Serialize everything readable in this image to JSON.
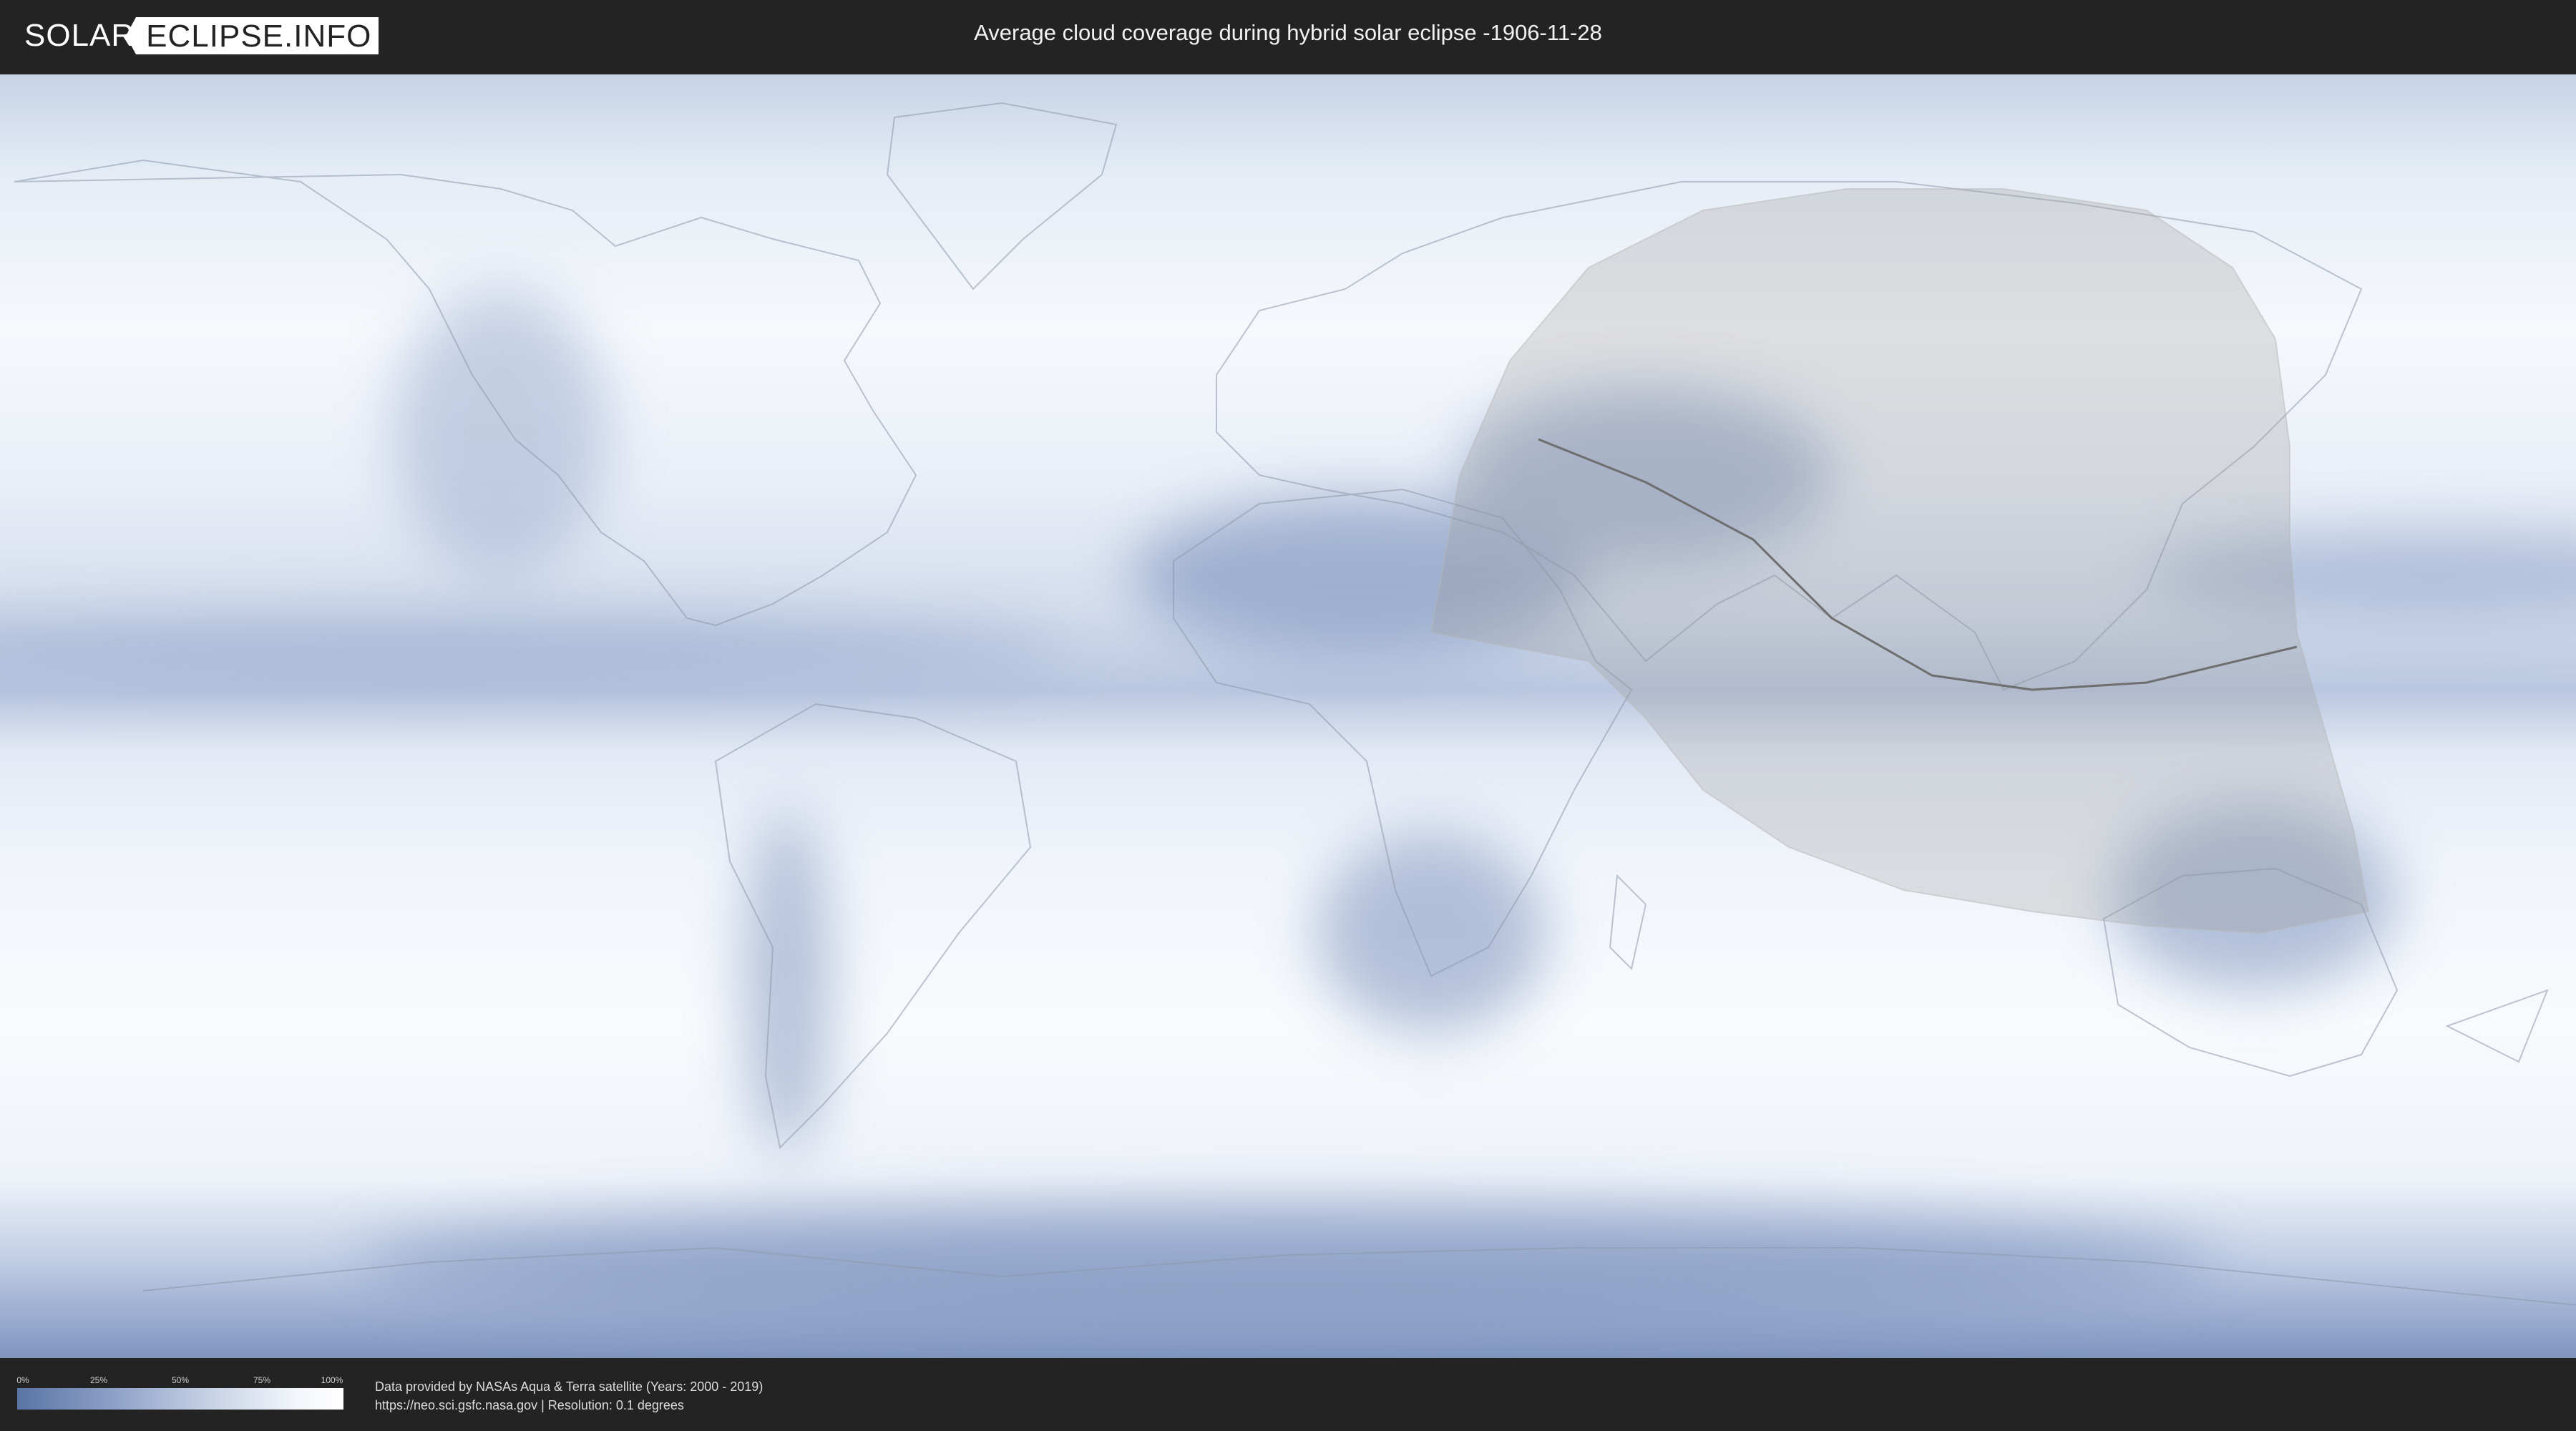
{
  "header": {
    "logo_solar": "SOLAR",
    "logo_eclipse": "ECLIPSE.INFO",
    "title": "Average cloud coverage during hybrid solar eclipse -1906-11-28"
  },
  "legend": {
    "ticks": [
      "0%",
      "25%",
      "50%",
      "75%",
      "100%"
    ],
    "colors": {
      "low": "#5a74a6",
      "high": "#ffffff"
    }
  },
  "footer": {
    "credit_line1": "Data provided by NASAs Aqua & Terra satellite (Years: 2000 - 2019)",
    "credit_line2": "https://neo.sci.gsfc.nasa.gov | Resolution: 0.1 degrees"
  },
  "colors": {
    "background": "#232323",
    "ocean_clear": "#f3f6fb",
    "cloud_blue": "#6f88b6",
    "eclipse_zone": "#9a9a9a"
  }
}
